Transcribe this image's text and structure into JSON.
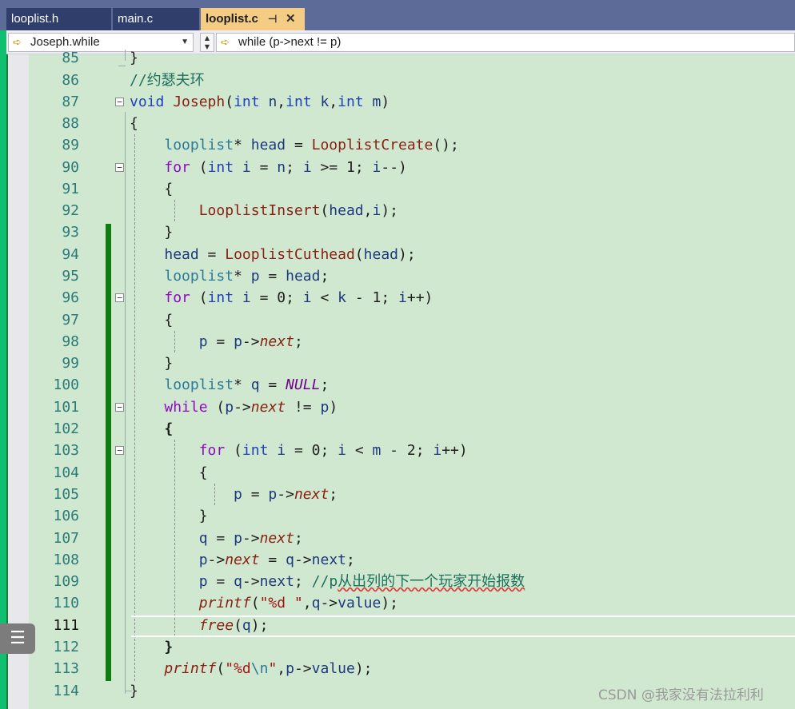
{
  "tabs": [
    {
      "label": "looplist.h"
    },
    {
      "label": "main.c"
    },
    {
      "label": "looplist.c",
      "pin": "⊣",
      "close": "✕"
    }
  ],
  "nav": {
    "scope": "Joseph.while",
    "member": "while (p->next != p)"
  },
  "editor": {
    "lines": [
      85,
      86,
      87,
      88,
      89,
      90,
      91,
      92,
      93,
      94,
      95,
      96,
      97,
      98,
      99,
      100,
      101,
      102,
      103,
      104,
      105,
      106,
      107,
      108,
      109,
      110,
      111,
      112,
      113,
      114
    ],
    "current_line": 111
  },
  "code": {
    "l86_comment": "//约瑟夫环",
    "l109_comment_p": "//p",
    "l109_comment_zh": "从出列的下一个玩家开始报数"
  },
  "watermark": "CSDN @我家没有法拉利利",
  "icons": [
    "tab-pin-icon",
    "tab-close-icon",
    "member-icon",
    "dropdown-arrow-icon",
    "spin-arrows-icon",
    "fold-collapse-icon",
    "list-menu-icon"
  ]
}
